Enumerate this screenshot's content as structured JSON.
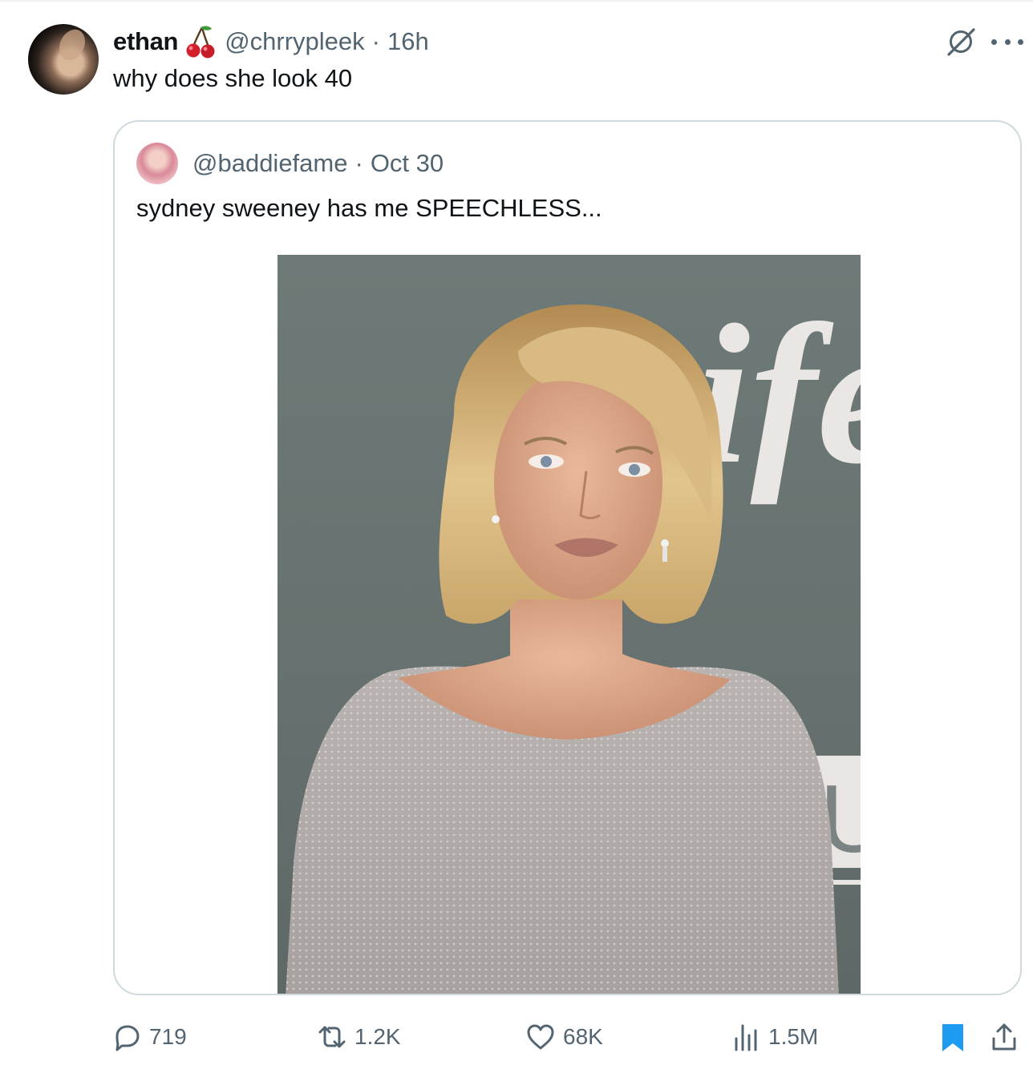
{
  "tweet": {
    "author": {
      "display_name": "ethan",
      "name_emoji": "cherry-emoji",
      "handle": "@chrrypleek",
      "time": "16h"
    },
    "text": "why does she look 40",
    "separator": "·"
  },
  "quoted_tweet": {
    "handle": "@baddiefame",
    "separator": "·",
    "date": "Oct 30",
    "text": "sydney sweeney has me SPEECHLESS...",
    "image": {
      "backdrop_text": "ife",
      "backdrop_text_2": "U"
    }
  },
  "actions": {
    "replies": "719",
    "reposts": "1.2K",
    "likes": "68K",
    "views": "1.5M"
  },
  "colors": {
    "text": "#0f1419",
    "secondary": "#536471",
    "border": "#cfd9de",
    "accent": "#1d9bf0"
  },
  "icons": [
    "grok-icon",
    "more-icon",
    "reply-icon",
    "retweet-icon",
    "like-icon",
    "views-icon",
    "bookmark-icon",
    "share-icon"
  ]
}
